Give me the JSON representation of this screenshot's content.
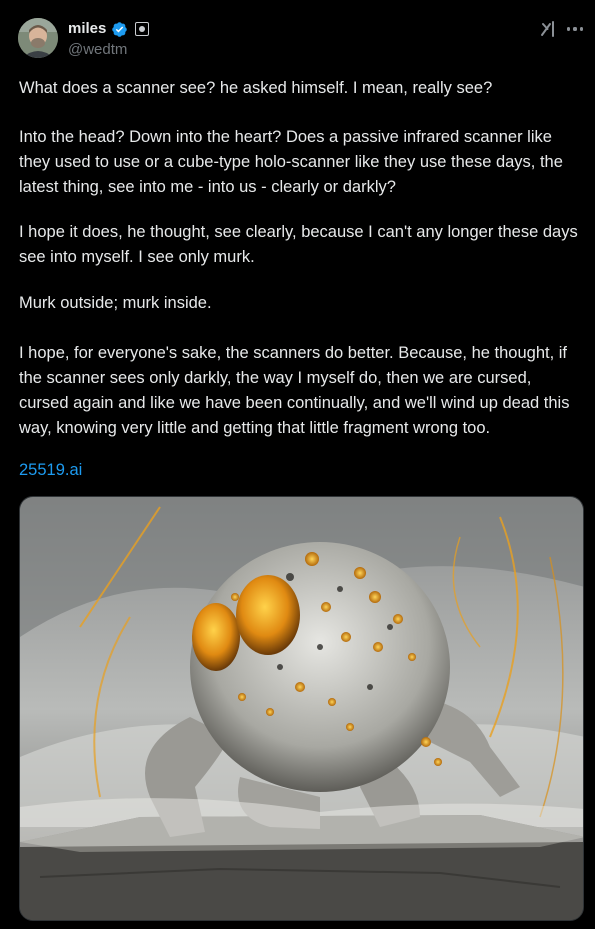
{
  "author": {
    "name": "miles",
    "handle": "@wedtm",
    "verified": true
  },
  "header_icons": {
    "avatar": "avatar",
    "verified": "verified-badge-icon",
    "affiliate": "affiliate-badge-icon",
    "grok": "grok-icon",
    "more": "more-options-icon"
  },
  "tweet": {
    "paragraphs": [
      "What does a scanner see? he asked himself. I mean, really see?",
      "Into the head? Down into the heart? Does a passive infrared scanner like they used to use or a cube-type holo-scanner like they use these days, the latest thing, see into me - into us - clearly or darkly?",
      "I hope it does, he thought, see clearly, because I can't any longer these days see into myself. I see only murk.",
      "Murk outside; murk inside.",
      "I hope, for everyone's sake, the scanners do better. Because, he thought, if the scanner sees only darkly, the way I myself do, then we are cursed, cursed again and like we have been continually, and we'll wind up dead this way, knowing very little and getting that little fragment wrong too."
    ],
    "link": "25519.ai"
  },
  "colors": {
    "background": "#000000",
    "text": "#e7e9ea",
    "secondary_text": "#71767b",
    "link": "#1d9bf0",
    "verified": "#1d9bf0"
  }
}
